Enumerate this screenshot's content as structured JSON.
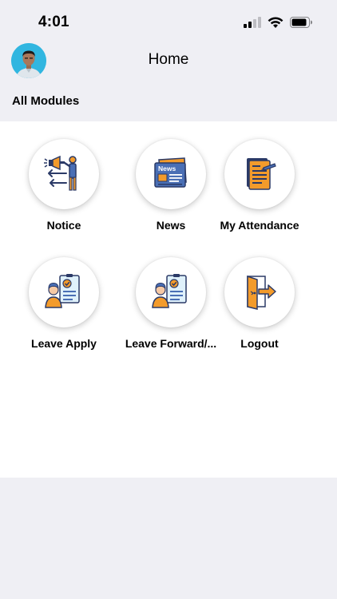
{
  "status_bar": {
    "time": "4:01"
  },
  "header": {
    "title": "Home"
  },
  "section": {
    "title": "All Modules"
  },
  "modules": [
    {
      "label": "Notice",
      "icon": "notice-icon"
    },
    {
      "label": "News",
      "icon": "news-icon"
    },
    {
      "label": "My Attendance",
      "icon": "attendance-icon"
    },
    {
      "label": "Leave Apply",
      "icon": "leave-apply-icon"
    },
    {
      "label": "Leave Forward/...",
      "icon": "leave-forward-icon"
    },
    {
      "label": "Logout",
      "icon": "logout-icon"
    }
  ],
  "news_icon_text": "News",
  "colors": {
    "accent_orange": "#f39b2b",
    "navy": "#2b3a67",
    "blue": "#4a6fb5",
    "avatar_bg": "#31b6e0",
    "background": "#efeff4"
  }
}
